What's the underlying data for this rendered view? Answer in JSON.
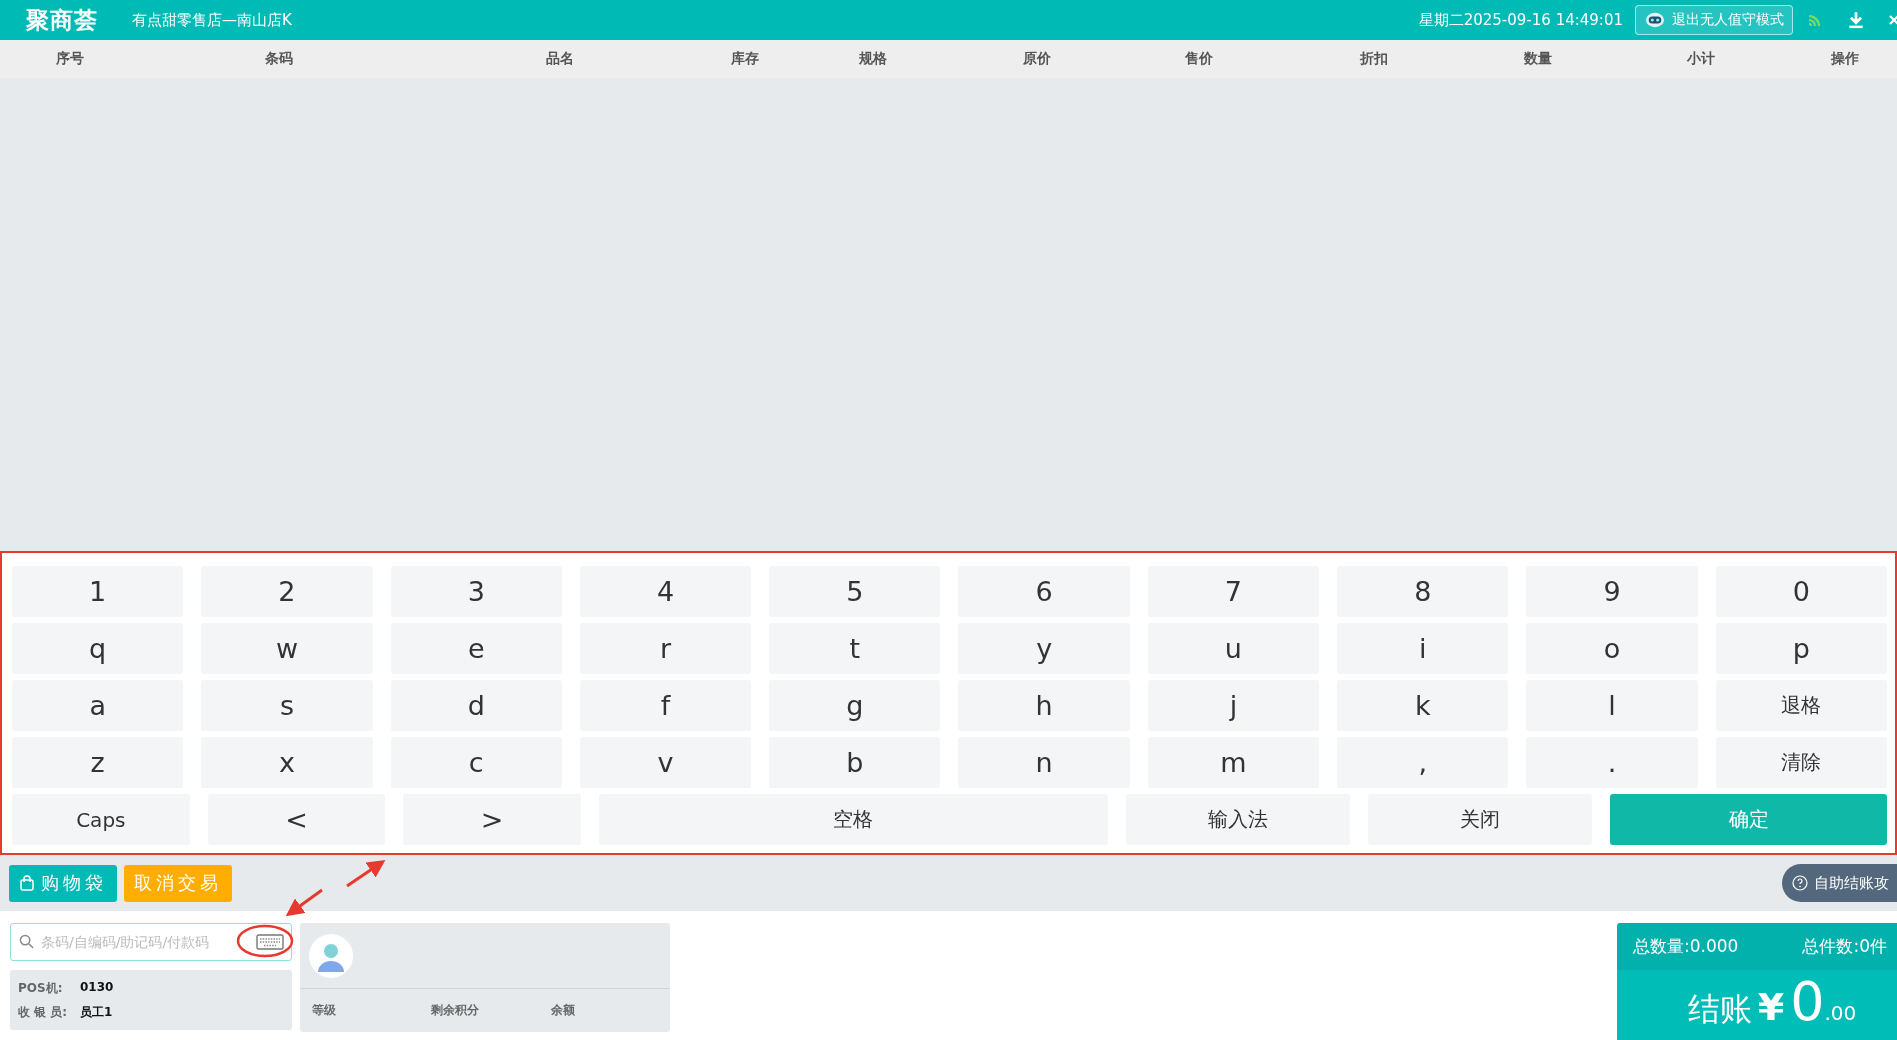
{
  "top_bar": {
    "logo": "聚商荟",
    "store": "有点甜零售店—南山店K",
    "datetime": "星期二2025-09-16 14:49:01",
    "mode_button": "退出无人值守模式"
  },
  "table": {
    "columns": [
      "序号",
      "条码",
      "品名",
      "库存",
      "规格",
      "原价",
      "售价",
      "折扣",
      "数量",
      "小计",
      "操作"
    ]
  },
  "keyboard": {
    "rows": [
      [
        {
          "label": "1",
          "kind": "key"
        },
        {
          "label": "2",
          "kind": "key"
        },
        {
          "label": "3",
          "kind": "key"
        },
        {
          "label": "4",
          "kind": "key"
        },
        {
          "label": "5",
          "kind": "key"
        },
        {
          "label": "6",
          "kind": "key"
        },
        {
          "label": "7",
          "kind": "key"
        },
        {
          "label": "8",
          "kind": "key"
        },
        {
          "label": "9",
          "kind": "key"
        },
        {
          "label": "0",
          "kind": "key"
        }
      ],
      [
        {
          "label": "q",
          "kind": "key"
        },
        {
          "label": "w",
          "kind": "key"
        },
        {
          "label": "e",
          "kind": "key"
        },
        {
          "label": "r",
          "kind": "key"
        },
        {
          "label": "t",
          "kind": "key"
        },
        {
          "label": "y",
          "kind": "key"
        },
        {
          "label": "u",
          "kind": "key"
        },
        {
          "label": "i",
          "kind": "key"
        },
        {
          "label": "o",
          "kind": "key"
        },
        {
          "label": "p",
          "kind": "key"
        }
      ],
      [
        {
          "label": "a",
          "kind": "key"
        },
        {
          "label": "s",
          "kind": "key"
        },
        {
          "label": "d",
          "kind": "key"
        },
        {
          "label": "f",
          "kind": "key"
        },
        {
          "label": "g",
          "kind": "key"
        },
        {
          "label": "h",
          "kind": "key"
        },
        {
          "label": "j",
          "kind": "key"
        },
        {
          "label": "k",
          "kind": "key"
        },
        {
          "label": "l",
          "kind": "key"
        },
        {
          "label": "退格",
          "kind": "action"
        }
      ],
      [
        {
          "label": "z",
          "kind": "key"
        },
        {
          "label": "x",
          "kind": "key"
        },
        {
          "label": "c",
          "kind": "key"
        },
        {
          "label": "v",
          "kind": "key"
        },
        {
          "label": "b",
          "kind": "key"
        },
        {
          "label": "n",
          "kind": "key"
        },
        {
          "label": "m",
          "kind": "key"
        },
        {
          "label": ",",
          "kind": "key"
        },
        {
          "label": ".",
          "kind": "key"
        },
        {
          "label": "清除",
          "kind": "action"
        }
      ]
    ],
    "function_keys": [
      {
        "label": "Caps",
        "kind": "action"
      },
      {
        "label": "<",
        "kind": "key"
      },
      {
        "label": ">",
        "kind": "key"
      },
      {
        "label": "空格",
        "kind": "space"
      },
      {
        "label": "输入法",
        "kind": "wide"
      },
      {
        "label": "关闭",
        "kind": "wide"
      },
      {
        "label": "确定",
        "kind": "confirm"
      }
    ]
  },
  "toolbar": {
    "bag_button": "购物袋",
    "cancel_button": "取消交易",
    "help_button": "自助结账攻"
  },
  "search": {
    "placeholder": "条码/自编码/助记码/付款码"
  },
  "terminal": [
    {
      "label": "POS机:",
      "value": "0130"
    },
    {
      "label": "收 银 员:",
      "value": "员工1"
    }
  ],
  "member": {
    "fields": [
      "等级",
      "剩余积分",
      "余额"
    ]
  },
  "totals": {
    "quantity": "总数量:0.000",
    "pieces": "总件数:0件",
    "checkout_label": "结账",
    "currency": "¥",
    "amount_integer": "0",
    "amount_decimals": ".00"
  }
}
